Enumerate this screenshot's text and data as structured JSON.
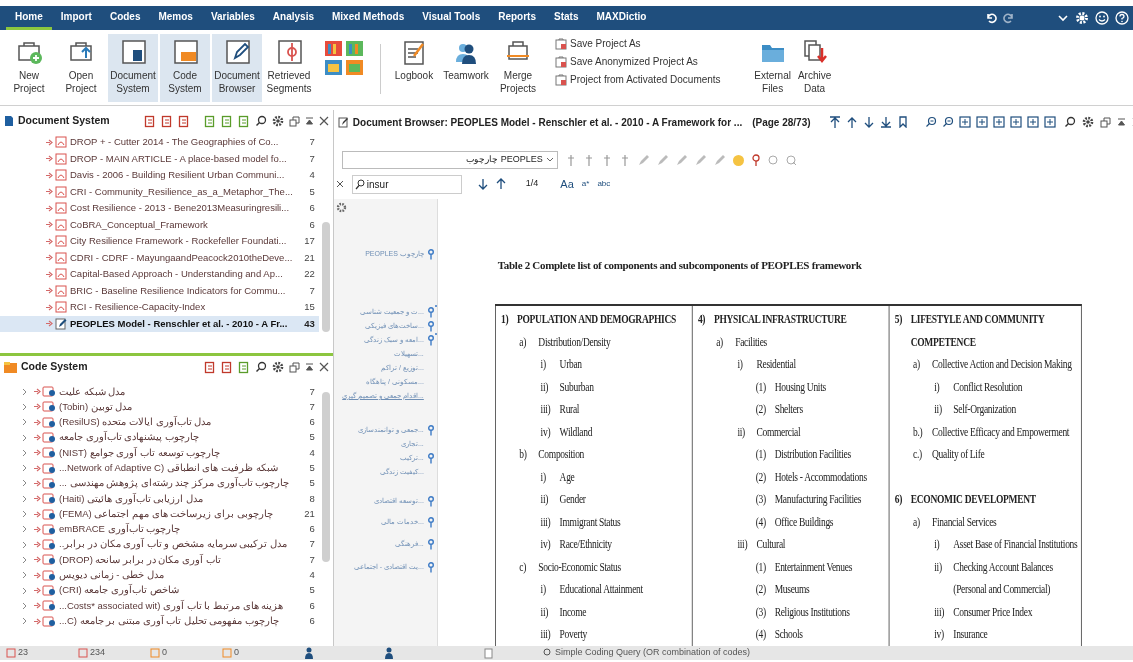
{
  "menu_tabs": [
    {
      "label": "Home",
      "selected": true
    },
    {
      "label": "Import",
      "selected": false
    },
    {
      "label": "Codes",
      "selected": false
    },
    {
      "label": "Memos",
      "selected": false
    },
    {
      "label": "Variables",
      "selected": false
    },
    {
      "label": "Analysis",
      "selected": false
    },
    {
      "label": "Mixed Methods",
      "selected": false
    },
    {
      "label": "Visual Tools",
      "selected": false
    },
    {
      "label": "Reports",
      "selected": false
    },
    {
      "label": "Stats",
      "selected": false
    },
    {
      "label": "MAXDictio",
      "selected": false
    }
  ],
  "ribbon": [
    {
      "label": "New Project",
      "on": false
    },
    {
      "label": "Open Project",
      "on": false
    },
    {
      "label": "Document System",
      "on": true
    },
    {
      "label": "Code System",
      "on": true
    },
    {
      "label": "Document Browser",
      "on": true
    },
    {
      "label": "Retrieved Segments",
      "on": false
    },
    {
      "label": "Logbook",
      "on": false
    },
    {
      "label": "Teamwork",
      "on": false
    },
    {
      "label": "Merge Projects",
      "on": false
    }
  ],
  "save_commands": [
    "Save Project As",
    "Save Anonymized Project As",
    "Project from Activated Documents"
  ],
  "ribbon_extra": [
    "External Files",
    "Archive Data"
  ],
  "document_system": {
    "title": "Document System",
    "items": [
      {
        "name": "DROP + - Cutter 2014 - The Geographies of Co...",
        "count": "7",
        "selected": false
      },
      {
        "name": "DROP - MAIN ARTICLE - A place-based model fo...",
        "count": "7",
        "selected": false
      },
      {
        "name": "Davis - 2006 - Building Resilient Urban Communi...",
        "count": "4",
        "selected": false
      },
      {
        "name": "CRI - Community_Resilience_as_a_Metaphor_The...",
        "count": "5",
        "selected": false
      },
      {
        "name": "Cost Resilience - 2013 - Bene2013Measuringresili...",
        "count": "6",
        "selected": false
      },
      {
        "name": "CoBRA_Conceptual_Framework",
        "count": "6",
        "selected": false
      },
      {
        "name": "City Resilience Framework - Rockefeller Foundati...",
        "count": "17",
        "selected": false
      },
      {
        "name": "CDRI - CDRF - MayungaandPeacock2010theDeve...",
        "count": "21",
        "selected": false
      },
      {
        "name": "Capital-Based Approach - Understanding and Ap...",
        "count": "22",
        "selected": false
      },
      {
        "name": "BRIC - Baseline Resilience Indicators for Commu...",
        "count": "7",
        "selected": false
      },
      {
        "name": "RCI - Resilience-Capacity-Index",
        "count": "15",
        "selected": false
      },
      {
        "name": "PEOPLES Model - Renschler et al. - 2010 - A Fr...",
        "count": "43",
        "selected": true
      }
    ]
  },
  "code_system": {
    "title": "Code System",
    "items": [
      {
        "name": "مدل شبکه علیت",
        "count": "7"
      },
      {
        "name": "مدل توبین (Tobin)",
        "count": "7"
      },
      {
        "name": "مدل تاب‌آوری ایالات متحده (ResilUS)",
        "count": "6"
      },
      {
        "name": "چارچوب پیشنهادی تاب‌آوری جامعه",
        "count": "5"
      },
      {
        "name": "چارچوب توسعه تاب آوری جوامع (NIST)",
        "count": "4"
      },
      {
        "name": "شبکه ظرفیت های انطباقی (Network of Adaptive C...",
        "count": "5"
      },
      {
        "name": "چارچوب تاب‌آوری مرکز چند رشته‌ای پژوهش مهندسی ...",
        "count": "5"
      },
      {
        "name": "مدل ارزیابی تاب‌آوری هائیتی (Haiti)",
        "count": "8"
      },
      {
        "name": "چارچوبی برای زیرساخت های مهم اجتماعی (FEMA)",
        "count": "21"
      },
      {
        "name": "چارچوب تاب‌آوری emBRACE",
        "count": "6"
      },
      {
        "name": "مدل ترکیبی سرمایه مشخص و تاب آوری مکان در برابر..",
        "count": "7"
      },
      {
        "name": "تاب آوری مکان در برابر سانحه (DROP)",
        "count": "7"
      },
      {
        "name": "مدل خطی - زمانی دیویس",
        "count": "4"
      },
      {
        "name": "شاخص تاب‌آوری جامعه (CRI)",
        "count": "5"
      },
      {
        "name": "هزینه های مرتبط با تاب آوری (Costs* associated wit...",
        "count": "6"
      },
      {
        "name": "چارچوب مفهومی تحلیل تاب آوری مبتنی بر جامعه (C...",
        "count": "6"
      }
    ]
  },
  "document_browser": {
    "title": "Document Browser: PEOPLES Model - Renschler et al. - 2010 - A Framework for ...",
    "page": "(Page 28/73)",
    "code_dropdown": "PEOPLES چارچوب",
    "search": {
      "value": "insur",
      "matches": "1/4",
      "options": [
        "Aa",
        "a*",
        "abc"
      ]
    },
    "margin_codes": [
      "چارچوب PEOPLES",
      "...ت و جمعیت شناسی",
      "...ساخت‌های فیزیکی",
      "...امعه و سبک زندگی",
      "...تسهیلات",
      "...توزیع / تراکم",
      "...مسکونی / پناهگاه",
      "...اقدام جمعی و تصمیم گیری",
      "...جمعی و توانمندسازی",
      "...تجاری",
      "...ترکیب",
      "...کیفیت زندگی",
      "...توسعه اقتصادی",
      "...خدمات مالی",
      "...فرهنگی",
      "...یت اقتصادی - اجتماعی"
    ],
    "caption": "Table 2 Complete list of components and subcomponents of PEOPLES framework",
    "table_columns": [
      [
        {
          "marker": "1)",
          "text": "POPULATION AND DEMOGRAPHICS",
          "children": [
            {
              "marker": "a)",
              "text": "Distribution/Density",
              "children": [
                {
                  "marker": "i)",
                  "text": "Urban"
                },
                {
                  "marker": "ii)",
                  "text": "Suburban"
                },
                {
                  "marker": "iii)",
                  "text": "Rural"
                },
                {
                  "marker": "iv)",
                  "text": "Wildland"
                }
              ]
            },
            {
              "marker": "b)",
              "text": "Composition",
              "children": [
                {
                  "marker": "i)",
                  "text": "Age"
                },
                {
                  "marker": "ii)",
                  "text": "Gender"
                },
                {
                  "marker": "iii)",
                  "text": "Immigrant Status"
                },
                {
                  "marker": "iv)",
                  "text": "Race/Ethnicity"
                }
              ]
            },
            {
              "marker": "c)",
              "text": "Socio-Economic Status",
              "children": [
                {
                  "marker": "i)",
                  "text": "Educational Attainment"
                },
                {
                  "marker": "ii)",
                  "text": "Income"
                },
                {
                  "marker": "iii)",
                  "text": "Poverty"
                }
              ]
            }
          ]
        }
      ],
      [
        {
          "marker": "4)",
          "text": "PHYSICAL INFRASTRUCTURE",
          "children": [
            {
              "marker": "a)",
              "text": "Facilities",
              "children": [
                {
                  "marker": "i)",
                  "text": "Residential",
                  "children": [
                    {
                      "marker": "(1)",
                      "text": "Housing Units"
                    },
                    {
                      "marker": "(2)",
                      "text": "Shelters"
                    }
                  ]
                },
                {
                  "marker": "ii)",
                  "text": "Commercial",
                  "children": [
                    {
                      "marker": "(1)",
                      "text": "Distribution Facilities"
                    },
                    {
                      "marker": "(2)",
                      "text": "Hotels - Accommodations"
                    },
                    {
                      "marker": "(3)",
                      "text": "Manufacturing Facilities"
                    },
                    {
                      "marker": "(4)",
                      "text": "Office Buildings"
                    }
                  ]
                },
                {
                  "marker": "iii)",
                  "text": "Cultural",
                  "children": [
                    {
                      "marker": "(1)",
                      "text": "Entertainment Venues"
                    },
                    {
                      "marker": "(2)",
                      "text": "Museums"
                    },
                    {
                      "marker": "(3)",
                      "text": "Religious Institutions"
                    },
                    {
                      "marker": "(4)",
                      "text": "Schools"
                    }
                  ]
                }
              ]
            }
          ]
        }
      ],
      [
        {
          "marker": "5)",
          "text": "LIFESTYLE AND COMMUNITY COMPETENCE",
          "children": [
            {
              "marker": "a)",
              "text": "Collective Action and Decision Making",
              "children": [
                {
                  "marker": "i)",
                  "text": "Conflict Resolution"
                },
                {
                  "marker": "ii)",
                  "text": "Self-Organization"
                }
              ]
            },
            {
              "marker": "b.)",
              "text": "Collective Efficacy and Empowerment"
            },
            {
              "marker": "c.)",
              "text": "Quality of Life"
            }
          ]
        },
        {
          "marker": "6)",
          "text": "ECONOMIC DEVELOPMENT",
          "children": [
            {
              "marker": "a)",
              "text": "Financial Services",
              "children": [
                {
                  "marker": "i)",
                  "text": "Asset Base of Financial Institutions"
                },
                {
                  "marker": "ii)",
                  "text": "Checking Account Balances (Personal and Commercial)"
                },
                {
                  "marker": "iii)",
                  "text": "Consumer Price Index"
                },
                {
                  "marker": "iv)",
                  "text": "Insurance"
                }
              ]
            }
          ]
        }
      ]
    ]
  },
  "status_bar": {
    "counts": [
      "23",
      "234",
      "0",
      "0"
    ],
    "query": "Simple Coding Query (OR combination of codes)"
  }
}
